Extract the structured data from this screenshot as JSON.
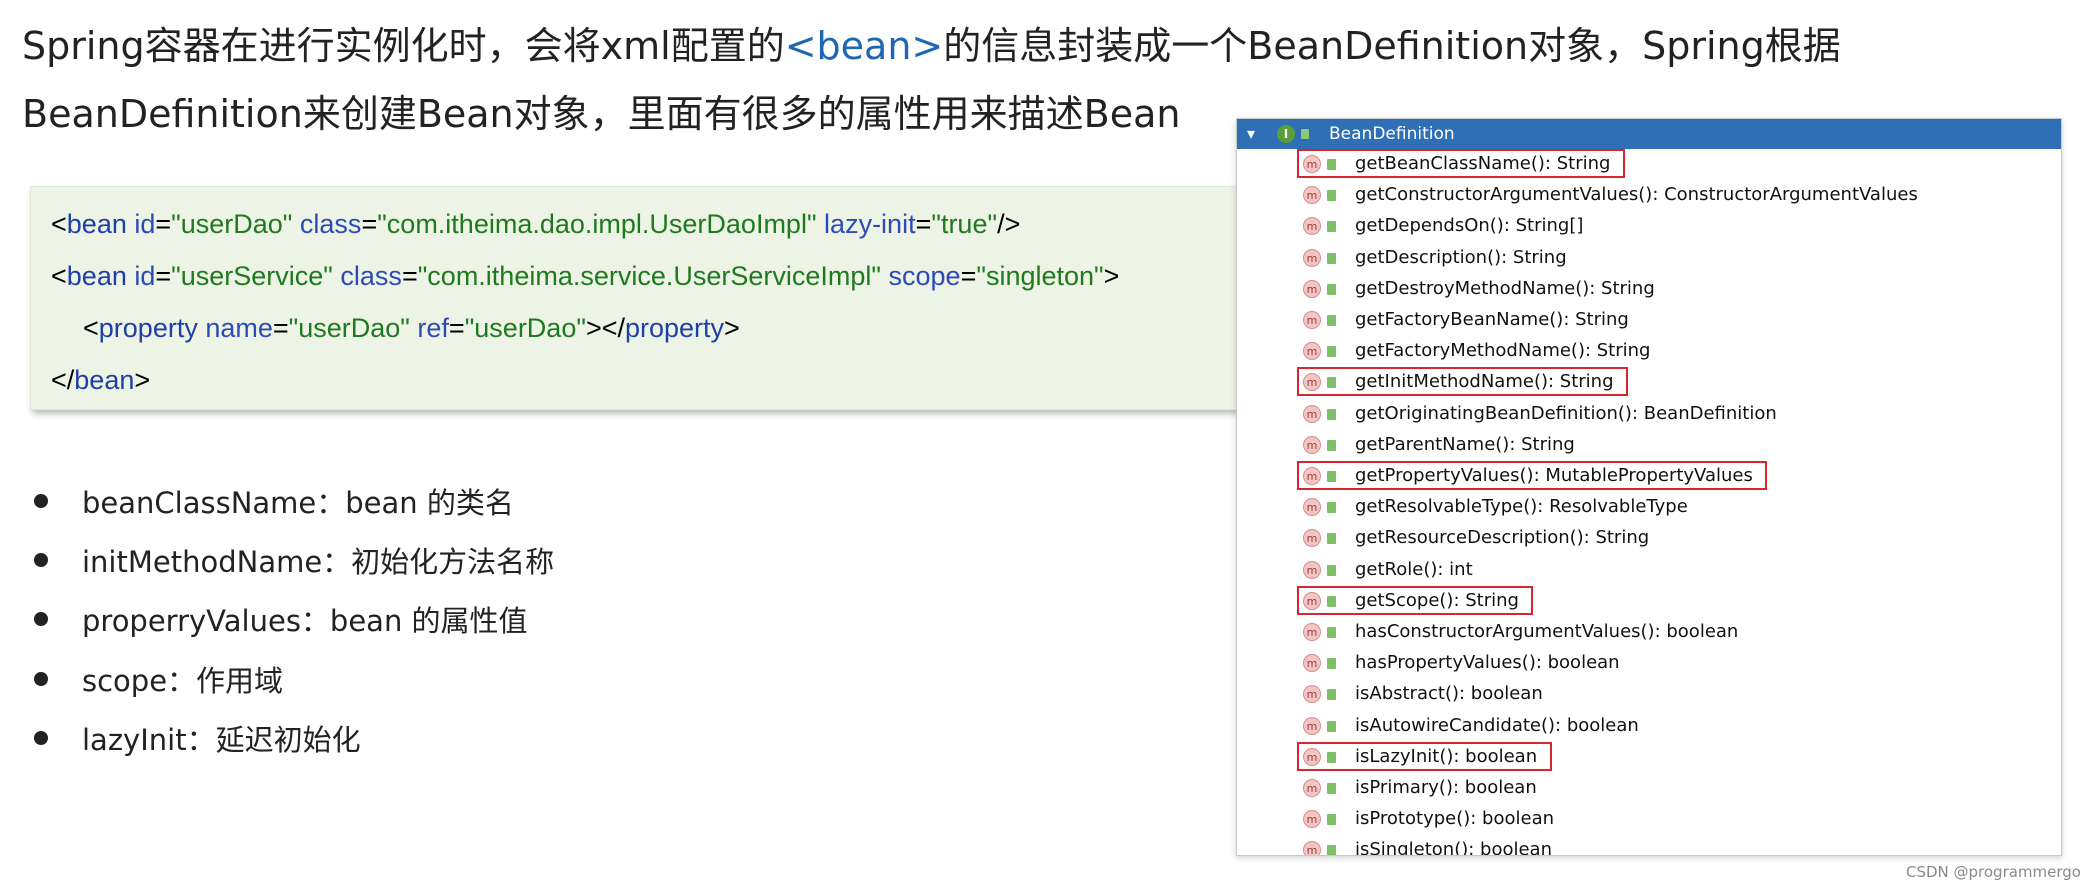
{
  "intro": {
    "part1": "Spring容器在进行实例化时，会将xml配置的",
    "tag": "<bean>",
    "part2": "的信息封装成一个BeanDefinition对象，Spring根据",
    "line2": "BeanDefinition来创建Bean对象，里面有很多的属性用来描述Bean"
  },
  "code": {
    "lines": [
      [
        {
          "t": "<",
          "k": "plain"
        },
        {
          "t": "bean",
          "k": "tag"
        },
        {
          "t": " id",
          "k": "attr"
        },
        {
          "t": "=",
          "k": "plain"
        },
        {
          "t": "\"userDao\"",
          "k": "val"
        },
        {
          "t": " class",
          "k": "attr"
        },
        {
          "t": "=",
          "k": "plain"
        },
        {
          "t": "\"com.itheima.dao.impl.UserDaoImpl\"",
          "k": "val"
        },
        {
          "t": " lazy-init",
          "k": "attr"
        },
        {
          "t": "=",
          "k": "plain"
        },
        {
          "t": "\"true\"",
          "k": "val"
        },
        {
          "t": "/>",
          "k": "plain"
        }
      ],
      [
        {
          "t": "<",
          "k": "plain"
        },
        {
          "t": "bean",
          "k": "tag"
        },
        {
          "t": " id",
          "k": "attr"
        },
        {
          "t": "=",
          "k": "plain"
        },
        {
          "t": "\"userService\"",
          "k": "val"
        },
        {
          "t": " class",
          "k": "attr"
        },
        {
          "t": "=",
          "k": "plain"
        },
        {
          "t": "\"com.itheima.service.UserServiceImpl\"",
          "k": "val"
        },
        {
          "t": " scope",
          "k": "attr"
        },
        {
          "t": "=",
          "k": "plain"
        },
        {
          "t": "\"singleton\"",
          "k": "val"
        },
        {
          "t": ">",
          "k": "plain"
        }
      ],
      [
        {
          "t": "<",
          "k": "plain"
        },
        {
          "t": "property",
          "k": "tag"
        },
        {
          "t": " name",
          "k": "attr"
        },
        {
          "t": "=",
          "k": "plain"
        },
        {
          "t": "\"userDao\"",
          "k": "val"
        },
        {
          "t": " ref",
          "k": "attr"
        },
        {
          "t": "=",
          "k": "plain"
        },
        {
          "t": "\"userDao\"",
          "k": "val"
        },
        {
          "t": "></",
          "k": "plain"
        },
        {
          "t": "property",
          "k": "tag"
        },
        {
          "t": ">",
          "k": "plain"
        }
      ],
      [
        {
          "t": "</",
          "k": "plain"
        },
        {
          "t": "bean",
          "k": "tag"
        },
        {
          "t": ">",
          "k": "plain"
        }
      ]
    ]
  },
  "bullets": [
    "beanClassName：bean 的类名",
    "initMethodName：初始化方法名称",
    "properryValues：bean 的属性值",
    "scope：作用域",
    "lazyInit：延迟初始化"
  ],
  "structure": {
    "title": "BeanDefinition",
    "collapse_icon": "chevron-down-icon",
    "interface_icon": "interface-icon",
    "method_icon_letter": "m",
    "highlight_color": "#d7262e",
    "header_color": "#2f6fb5",
    "methods": [
      {
        "sig": "getBeanClassName(): String",
        "highlighted": true
      },
      {
        "sig": "getConstructorArgumentValues(): ConstructorArgumentValues",
        "highlighted": false
      },
      {
        "sig": "getDependsOn(): String[]",
        "highlighted": false
      },
      {
        "sig": "getDescription(): String",
        "highlighted": false
      },
      {
        "sig": "getDestroyMethodName(): String",
        "highlighted": false
      },
      {
        "sig": "getFactoryBeanName(): String",
        "highlighted": false
      },
      {
        "sig": "getFactoryMethodName(): String",
        "highlighted": false
      },
      {
        "sig": "getInitMethodName(): String",
        "highlighted": true
      },
      {
        "sig": "getOriginatingBeanDefinition(): BeanDefinition",
        "highlighted": false
      },
      {
        "sig": "getParentName(): String",
        "highlighted": false
      },
      {
        "sig": "getPropertyValues(): MutablePropertyValues",
        "highlighted": true
      },
      {
        "sig": "getResolvableType(): ResolvableType",
        "highlighted": false
      },
      {
        "sig": "getResourceDescription(): String",
        "highlighted": false
      },
      {
        "sig": "getRole(): int",
        "highlighted": false
      },
      {
        "sig": "getScope(): String",
        "highlighted": true
      },
      {
        "sig": "hasConstructorArgumentValues(): boolean",
        "highlighted": false
      },
      {
        "sig": "hasPropertyValues(): boolean",
        "highlighted": false
      },
      {
        "sig": "isAbstract(): boolean",
        "highlighted": false
      },
      {
        "sig": "isAutowireCandidate(): boolean",
        "highlighted": false
      },
      {
        "sig": "isLazyInit(): boolean",
        "highlighted": true
      },
      {
        "sig": "isPrimary(): boolean",
        "highlighted": false
      },
      {
        "sig": "isPrototype(): boolean",
        "highlighted": false
      },
      {
        "sig": "isSingleton(): boolean",
        "highlighted": false
      }
    ]
  },
  "watermark": "CSDN @programmergo"
}
